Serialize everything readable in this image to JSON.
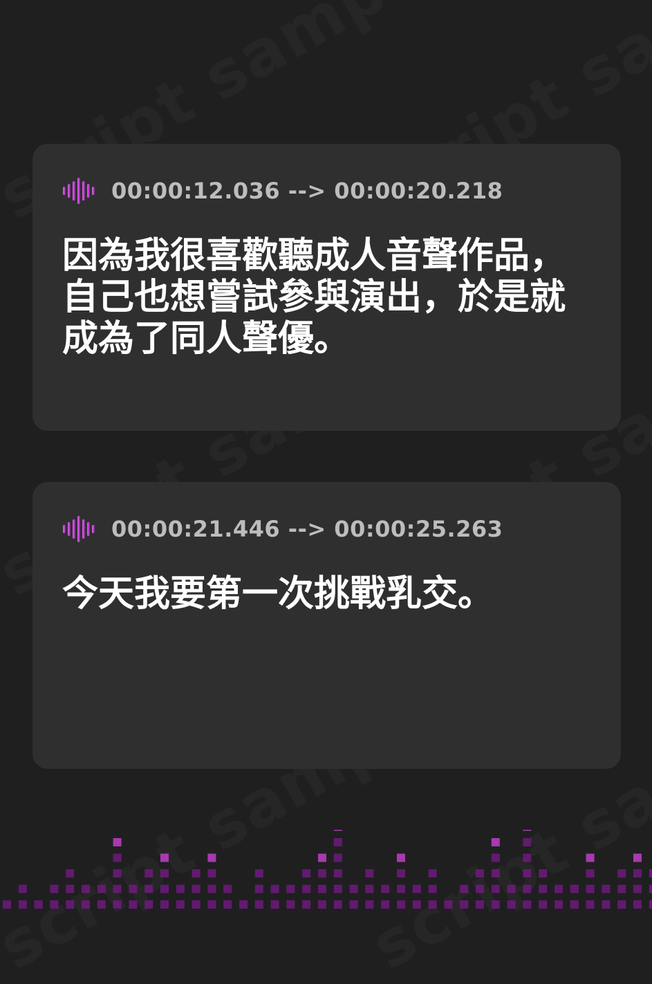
{
  "watermark": "script sample",
  "cues": [
    {
      "timestamp": "00:00:12.036 --> 00:00:20.218",
      "text": "因為我很喜歡聽成人音聲作品，\n自己也想嘗試參與演出，於是就\n成為了同人聲優。"
    },
    {
      "timestamp": "00:00:21.446 --> 00:00:25.263",
      "text": "今天我要第一次挑戰乳交。"
    }
  ],
  "colors": {
    "background": "#1f1f20",
    "card": "#2f2f30",
    "timestamp": "#bdbdbd",
    "subtitle": "#ffffff",
    "accent_magenta": "#c040c8",
    "accent_purple": "#7a1a8a"
  },
  "icons": {
    "cue_icon": "audio-wave-icon"
  }
}
